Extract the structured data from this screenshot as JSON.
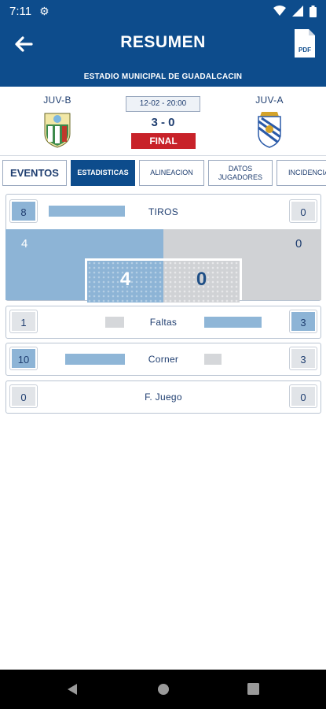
{
  "status_bar": {
    "time": "7:11"
  },
  "app_bar": {
    "title": "RESUMEN",
    "pdf_label": "PDF"
  },
  "stadium": "ESTADIO MUNICIPAL DE GUADALCACIN",
  "match": {
    "home": {
      "name": "JUV-B"
    },
    "away": {
      "name": "JUV-A"
    },
    "datetime": "12-02 - 20:00",
    "score": "3 - 0",
    "status": "FINAL"
  },
  "tabs": [
    {
      "label": "EVENTOS"
    },
    {
      "label": "ESTADISTICAS"
    },
    {
      "label": "ALINEACION"
    },
    {
      "label_line1": "DATOS",
      "label_line2": "JUGADORES"
    },
    {
      "label": "INCIDENCIA"
    }
  ],
  "stats": {
    "shots": {
      "label": "TIROS",
      "home": "8",
      "away": "0",
      "on_target_home": "4",
      "on_target_away": "0",
      "goal_home": "4",
      "goal_away": "0"
    },
    "fouls": {
      "label": "Faltas",
      "home": "1",
      "away": "3"
    },
    "corners": {
      "label": "Corner",
      "home": "10",
      "away": "3"
    },
    "offside": {
      "label": "F. Juego",
      "home": "0",
      "away": "0"
    }
  },
  "colors": {
    "primary": "#0d4c8c",
    "accent_red": "#c82229",
    "bar_blue": "#8fb6d7",
    "bar_gray": "#d5d7da"
  }
}
